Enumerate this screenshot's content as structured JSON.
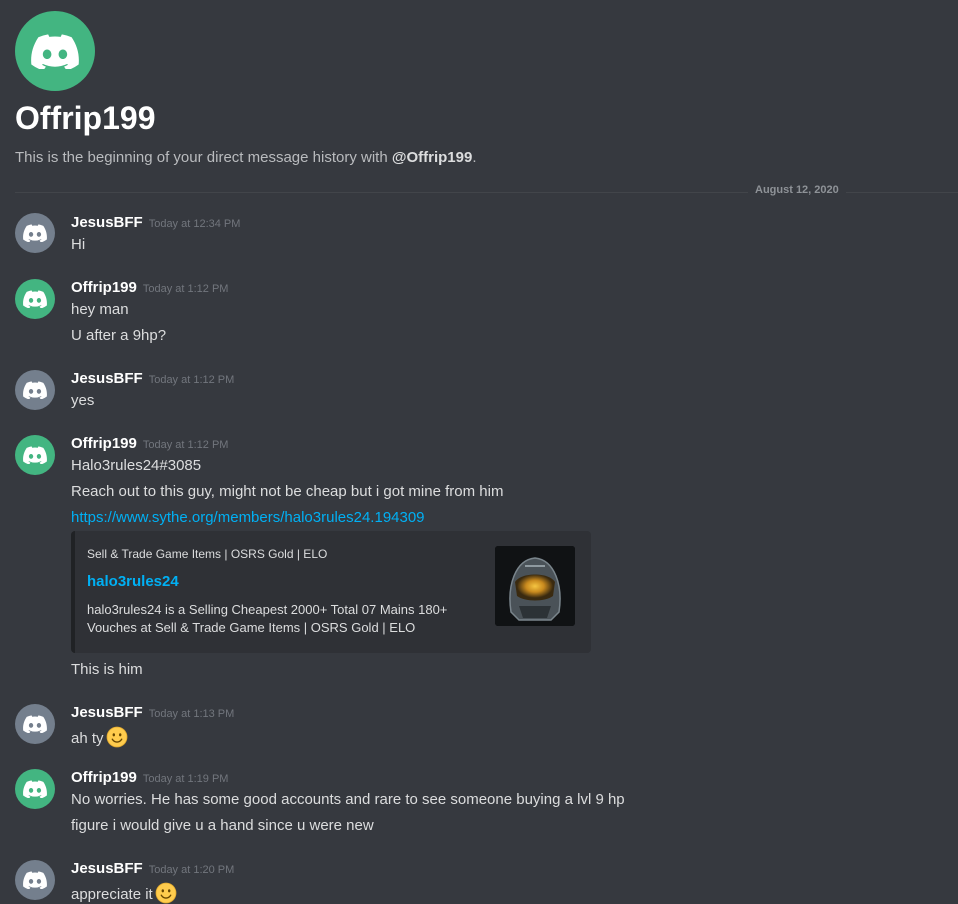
{
  "header": {
    "title": "Offrip199",
    "intro_prefix": "This is the beginning of your direct message history with ",
    "intro_mention": "@Offrip199",
    "intro_suffix": "."
  },
  "date_divider": "August 12, 2020",
  "messages": [
    {
      "author": "JesusBFF",
      "timestamp": "Today at 12:34 PM",
      "avatar_color": "#747f8d",
      "lines": [
        "Hi"
      ]
    },
    {
      "author": "Offrip199",
      "timestamp": "Today at 1:12 PM",
      "avatar_color": "#43b581",
      "lines": [
        "hey man",
        "U after a 9hp?"
      ]
    },
    {
      "author": "JesusBFF",
      "timestamp": "Today at 1:12 PM",
      "avatar_color": "#747f8d",
      "lines": [
        "yes"
      ]
    },
    {
      "author": "Offrip199",
      "timestamp": "Today at 1:12 PM",
      "avatar_color": "#43b581",
      "lines": [
        "Halo3rules24#3085",
        "Reach out to this guy, might not be cheap but i got mine from him"
      ],
      "link": "https://www.sythe.org/members/halo3rules24.194309",
      "embed": {
        "provider": "Sell & Trade Game Items | OSRS Gold | ELO",
        "title": "halo3rules24",
        "description": "halo3rules24 is a Selling Cheapest 2000+ Total 07 Mains 180+ Vouches at Sell & Trade Game Items | OSRS Gold | ELO",
        "thumbnail_icon": "helmet-thumbnail"
      },
      "after_embed": "This is him"
    },
    {
      "author": "JesusBFF",
      "timestamp": "Today at 1:13 PM",
      "avatar_color": "#747f8d",
      "lines": [
        "ah ty"
      ],
      "emoji": "slightly-smiling-face"
    },
    {
      "author": "Offrip199",
      "timestamp": "Today at 1:19 PM",
      "avatar_color": "#43b581",
      "lines": [
        "No worries. He has some good accounts and rare to see someone buying a lvl 9 hp",
        "figure i would give u a hand since u were new"
      ]
    },
    {
      "author": "JesusBFF",
      "timestamp": "Today at 1:20 PM",
      "avatar_color": "#747f8d",
      "lines": [
        "appreciate it"
      ],
      "emoji": "slightly-smiling-face"
    }
  ],
  "colors": {
    "background": "#36393f",
    "link": "#00b0f4",
    "green_avatar": "#43b581",
    "gray_avatar": "#747f8d"
  }
}
